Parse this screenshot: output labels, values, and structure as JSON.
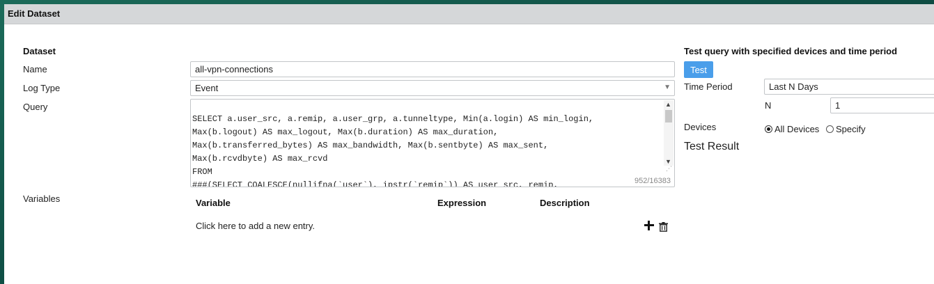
{
  "dialog": {
    "title": "Edit Dataset"
  },
  "dataset": {
    "heading": "Dataset",
    "name_label": "Name",
    "name_value": "all-vpn-connections",
    "log_type_label": "Log Type",
    "log_type_value": "Event",
    "query_label": "Query",
    "query_lines": [
      "SELECT a.user_src, a.remip, a.user_grp, a.tunneltype, Min(a.login) AS min_login,",
      "Max(b.logout) AS max_logout, Max(b.duration) AS max_duration,",
      "Max(b.transferred_bytes) AS max_bandwidth, Max(b.sentbyte) AS max_sent,",
      "Max(b.rcvdbyte) AS max_rcvd",
      "FROM",
      "###(SELECT COALESCE(nullifna(`user`), ipstr(`remip`)) AS user_src, remip,"
    ],
    "query_char_count": "952/16383"
  },
  "variables": {
    "label": "Variables",
    "columns": [
      "Variable",
      "Expression",
      "Description"
    ],
    "add_entry_text": "Click here to add a new entry."
  },
  "test": {
    "heading": "Test query with specified devices and time period",
    "test_button": "Test",
    "time_period_label": "Time Period",
    "time_period_value": "Last N Days",
    "n_label": "N",
    "n_value": "1",
    "devices_label": "Devices",
    "devices_options": [
      {
        "label": "All Devices",
        "selected": true
      },
      {
        "label": "Specify",
        "selected": false
      }
    ],
    "result_heading": "Test Result"
  },
  "colors": {
    "accent": "#4a9eea",
    "titlebar": "#d5d7d9",
    "background": "#0f4f45"
  },
  "icons": {
    "add": "plus-icon",
    "delete": "trash-icon",
    "dropdown": "chevron-down-icon"
  }
}
